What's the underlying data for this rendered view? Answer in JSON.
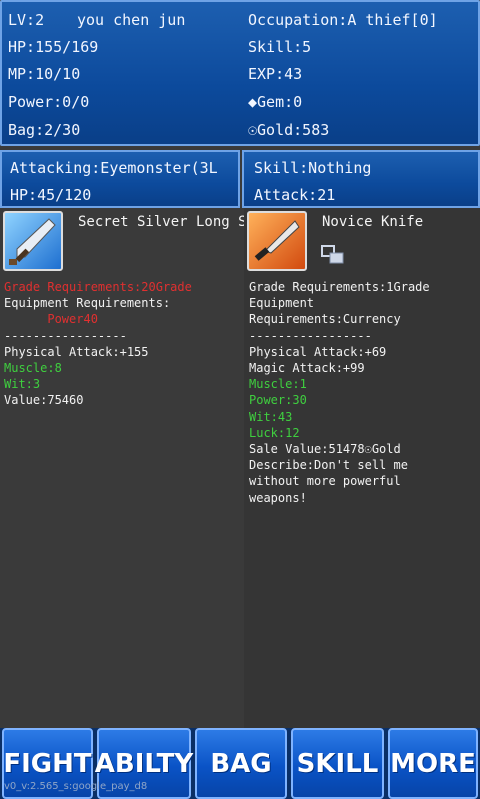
{
  "stats": {
    "level": "LV:2",
    "name": "you chen jun",
    "occupation": "Occupation:A thief[0]",
    "hp": "HP:155/169",
    "skill": "Skill:5",
    "mp": "MP:10/10",
    "exp": "EXP:43",
    "power": "Power:0/0",
    "gem": "◆Gem:0",
    "bag": "Bag:2/30",
    "gold": "☉Gold:583"
  },
  "combat": {
    "attacking": "Attacking:Eyemonster(3L",
    "enemy_hp": "HP:45/120",
    "skill": "Skill:Nothing",
    "attack": "Attack:21"
  },
  "left_item": {
    "icon": "sword-icon",
    "name": "Secret Silver Long S",
    "lines": [
      {
        "text": "Grade Requirements:20Grade",
        "color": "red"
      },
      {
        "text": "Equipment Requirements:",
        "color": "white"
      },
      {
        "text": "      Power40",
        "color": "red"
      },
      {
        "text": "-----------------",
        "color": "white"
      },
      {
        "text": "Physical Attack:+155",
        "color": "white"
      },
      {
        "text": "Muscle:8",
        "color": "green"
      },
      {
        "text": "Wit:3",
        "color": "green"
      },
      {
        "text": "Value:75460",
        "color": "white"
      }
    ]
  },
  "right_item": {
    "icon": "knife-icon",
    "name": "Novice Knife",
    "lines": [
      {
        "text": "Grade Requirements:1Grade",
        "color": "white"
      },
      {
        "text": "Equipment",
        "color": "white"
      },
      {
        "text": "Requirements:Currency",
        "color": "white"
      },
      {
        "text": "-----------------",
        "color": "white"
      },
      {
        "text": "Physical Attack:+69",
        "color": "white"
      },
      {
        "text": "Magic Attack:+99",
        "color": "white"
      },
      {
        "text": "Muscle:1",
        "color": "green"
      },
      {
        "text": "Power:30",
        "color": "green"
      },
      {
        "text": "Wit:43",
        "color": "green"
      },
      {
        "text": "Luck:12",
        "color": "green"
      },
      {
        "text": "Sale Value:51478☉Gold",
        "color": "white"
      },
      {
        "text": "Describe:Don't sell me",
        "color": "white"
      },
      {
        "text": "without more powerful",
        "color": "white"
      },
      {
        "text": "weapons!",
        "color": "white"
      }
    ]
  },
  "nav": {
    "fight": "FIGHT",
    "ability": "ABILTY",
    "bag": "BAG",
    "skill": "SKILL",
    "more": "MORE"
  },
  "version": "v0_v:2.565_s:google_pay_d8"
}
